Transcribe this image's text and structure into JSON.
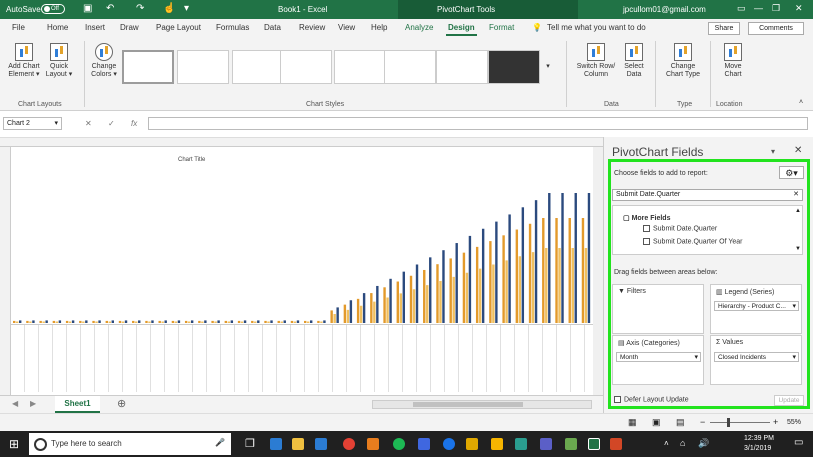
{
  "titlebar": {
    "autosave_label": "AutoSave",
    "autosave_state": "Off",
    "doc_title": "Book1 - Excel",
    "context_title": "PivotChart Tools",
    "user": "jpcullom01@gmail.com"
  },
  "tabs": [
    "File",
    "Home",
    "Insert",
    "Draw",
    "Page Layout",
    "Formulas",
    "Data",
    "Review",
    "View",
    "Help",
    "Analyze",
    "Design",
    "Format"
  ],
  "active_tab": "Design",
  "tell_me": "Tell me what you want to do",
  "share_label": "Share",
  "comments_label": "Comments",
  "ribbon": {
    "add_chart_element": [
      "Add Chart",
      "Element"
    ],
    "quick_layout": [
      "Quick",
      "Layout"
    ],
    "change_colors": [
      "Change",
      "Colors"
    ],
    "switch_row_col": [
      "Switch Row/",
      "Column"
    ],
    "select_data": [
      "Select",
      "Data"
    ],
    "change_chart_type": [
      "Change",
      "Chart Type"
    ],
    "move_chart": [
      "Move",
      "Chart"
    ],
    "groups": {
      "chart_layouts": "Chart Layouts",
      "chart_styles": "Chart Styles",
      "data": "Data",
      "type": "Type",
      "location": "Location"
    }
  },
  "name_box": "Chart 2",
  "chart": {
    "title": "Chart Title"
  },
  "sheet_tab": "Sheet1",
  "pivot": {
    "title": "PivotChart Fields",
    "choose_fields": "Choose fields to add to report:",
    "search_value": "Submit Date.Quarter",
    "more_fields": "More Fields",
    "field_1": "Submit Date.Quarter",
    "field_2": "Submit Date.Quarter Of Year",
    "drag_hint": "Drag fields between areas below:",
    "filters_title": "Filters",
    "legend_title": "Legend (Series)",
    "legend_value": "Hierarchy - Product C...",
    "axis_title": "Axis (Categories)",
    "axis_value": "Month",
    "values_title": "Values",
    "values_value": "Closed Incidents",
    "defer_label": "Defer Layout Update",
    "update_label": "Update"
  },
  "status": {
    "zoom": "55%"
  },
  "taskbar": {
    "search_placeholder": "Type here to search",
    "time": "12:39 PM",
    "date": "3/1/2019"
  },
  "colors": {
    "excel_green": "#217346",
    "highlight": "#22e31e",
    "series_blue": "#2b4a7e",
    "series_orange": "#e39a2b",
    "series_gold": "#f0c060"
  }
}
